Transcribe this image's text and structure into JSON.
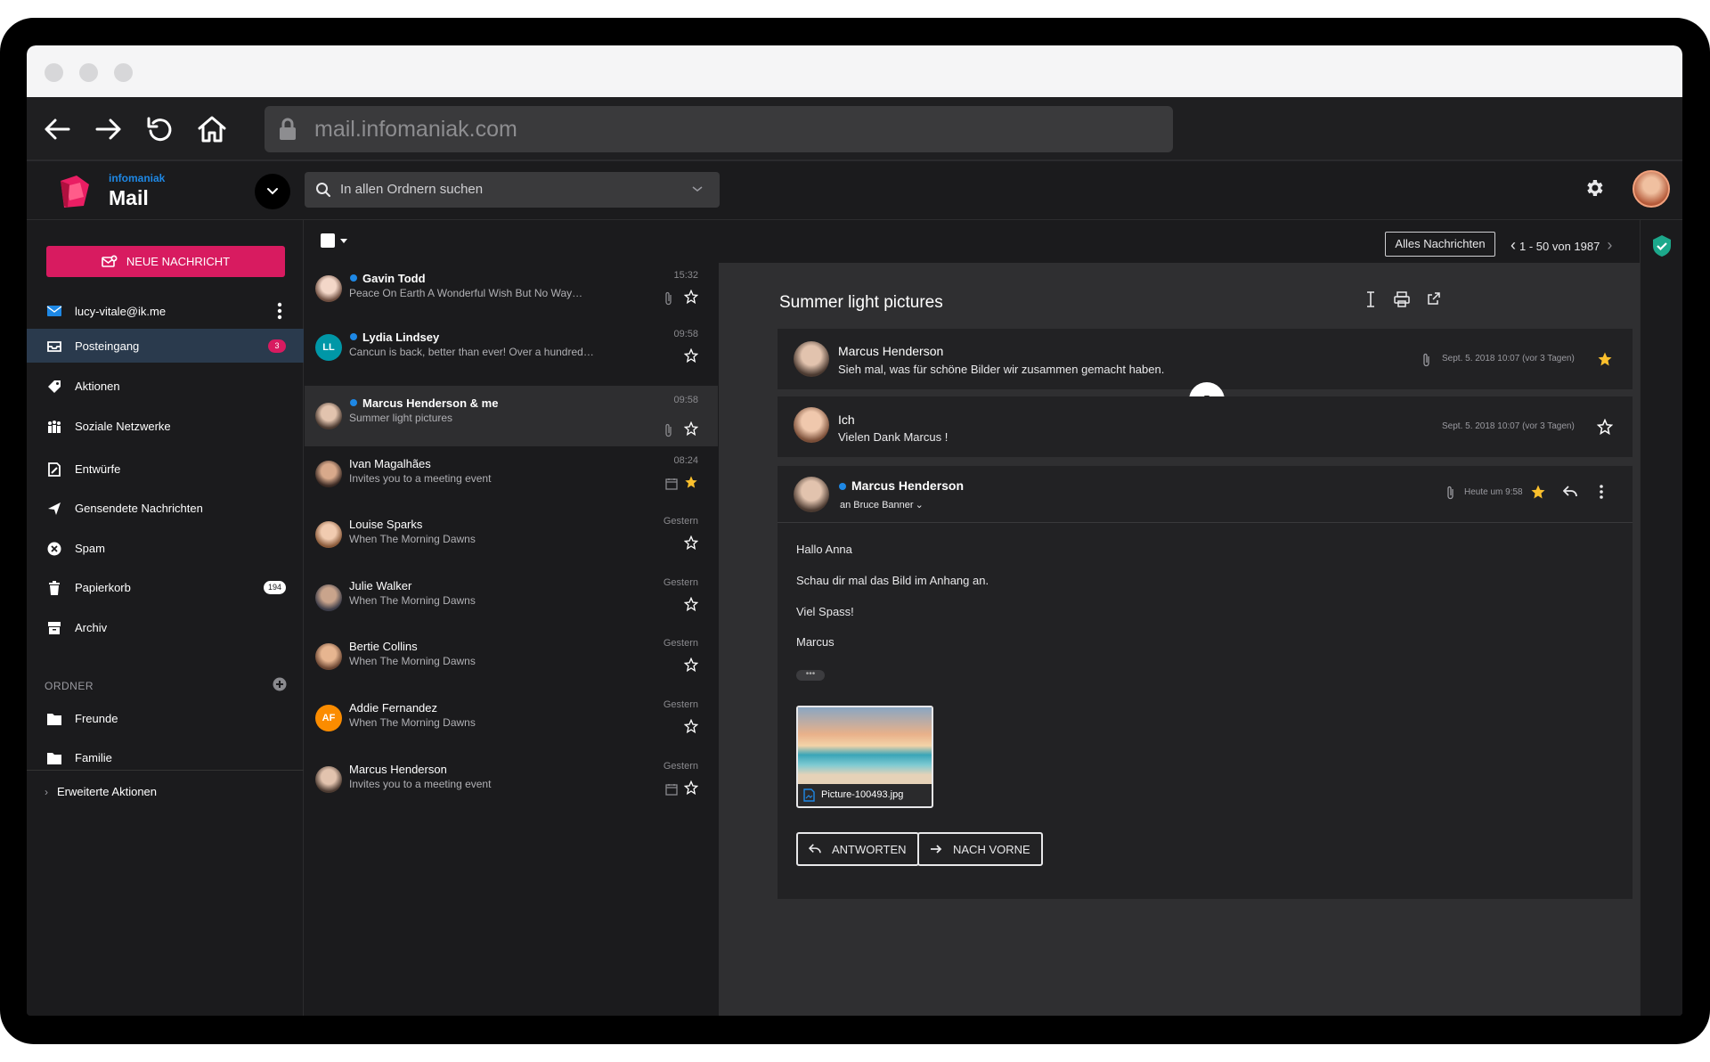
{
  "browser": {
    "url": "mail.infomaniak.com"
  },
  "app": {
    "brand_small": "infomaniak",
    "brand_name": "Mail",
    "search_placeholder": "In allen Ordnern suchen"
  },
  "sidebar": {
    "new_message": "NEUE NACHRICHT",
    "account": "lucy-vitale@ik.me",
    "items": [
      {
        "label": "Posteingang",
        "icon": "inbox-icon",
        "badge": "3",
        "active": true
      },
      {
        "label": "Aktionen",
        "icon": "tag-icon"
      },
      {
        "label": "Soziale Netzwerke",
        "icon": "people-icon"
      },
      {
        "label": "Entwürfe",
        "icon": "draft-icon"
      },
      {
        "label": "Gensendete Nachrichten",
        "icon": "send-icon"
      },
      {
        "label": "Spam",
        "icon": "spam-icon"
      },
      {
        "label": "Papierkorb",
        "icon": "trash-icon",
        "badge": "194"
      },
      {
        "label": "Archiv",
        "icon": "archive-icon"
      }
    ],
    "folders_header": "ORDNER",
    "folders": [
      {
        "label": "Freunde"
      },
      {
        "label": "Familie"
      }
    ],
    "extended_actions": "Erweiterte Aktionen"
  },
  "messages": [
    {
      "from": "Gavin Todd",
      "subject": "Peace On Earth A Wonderful Wish But No Way…",
      "time": "15:32",
      "unread": true,
      "starred": false,
      "attachment": true
    },
    {
      "from": "Lydia Lindsey",
      "subject": "Cancun is back, better than ever! Over a hundred…",
      "time": "09:58",
      "unread": true,
      "starred": false,
      "initials": "LL"
    },
    {
      "from": "Marcus Henderson & me",
      "subject": "Summer light pictures",
      "time": "09:58",
      "unread": true,
      "starred": false,
      "attachment": true,
      "selected": true
    },
    {
      "from": "Ivan Magalhães",
      "subject": "Invites you to a meeting event",
      "time": "08:24",
      "starred": true,
      "calendar": true
    },
    {
      "from": "Louise Sparks",
      "subject": "When The Morning Dawns",
      "time": "Gestern",
      "starred": false
    },
    {
      "from": "Julie Walker",
      "subject": "When The Morning Dawns",
      "time": "Gestern",
      "starred": false
    },
    {
      "from": "Bertie Collins",
      "subject": "When The Morning Dawns",
      "time": "Gestern",
      "starred": false
    },
    {
      "from": "Addie Fernandez",
      "subject": "When The Morning Dawns",
      "time": "Gestern",
      "starred": false,
      "initials": "AF"
    },
    {
      "from": "Marcus Henderson",
      "subject": "Invites you to a meeting event",
      "time": "Gestern",
      "starred": false,
      "calendar": true
    }
  ],
  "toolbar": {
    "filter": "Alles Nachrichten",
    "pager": "1 - 50 von 1987"
  },
  "thread": {
    "subject": "Summer light pictures",
    "collapsed_count": "5",
    "items": [
      {
        "from": "Marcus Henderson",
        "preview": "Sieh mal, was für schöne Bilder wir zusammen gemacht haben.",
        "date": "Sept. 5. 2018 10:07 (vor 3 Tagen)",
        "starred": true
      },
      {
        "from": "Ich",
        "preview": "Vielen Dank Marcus !",
        "date": "Sept. 5. 2018 10:07 (vor 3 Tagen)",
        "starred": false
      }
    ],
    "open": {
      "from": "Marcus Henderson",
      "to": "an Bruce Banner",
      "date": "Heute um 9:58",
      "body": [
        "Hallo Anna",
        "Schau dir mal das Bild im Anhang an.",
        "Viel Spass!",
        "Marcus"
      ],
      "attachment": "Picture-100493.jpg",
      "reply": "ANTWORTEN",
      "forward": "NACH VORNE"
    }
  },
  "colors": {
    "accent": "#d81b60",
    "unread_dot": "#1e88e5",
    "star": "#fbc02d"
  }
}
